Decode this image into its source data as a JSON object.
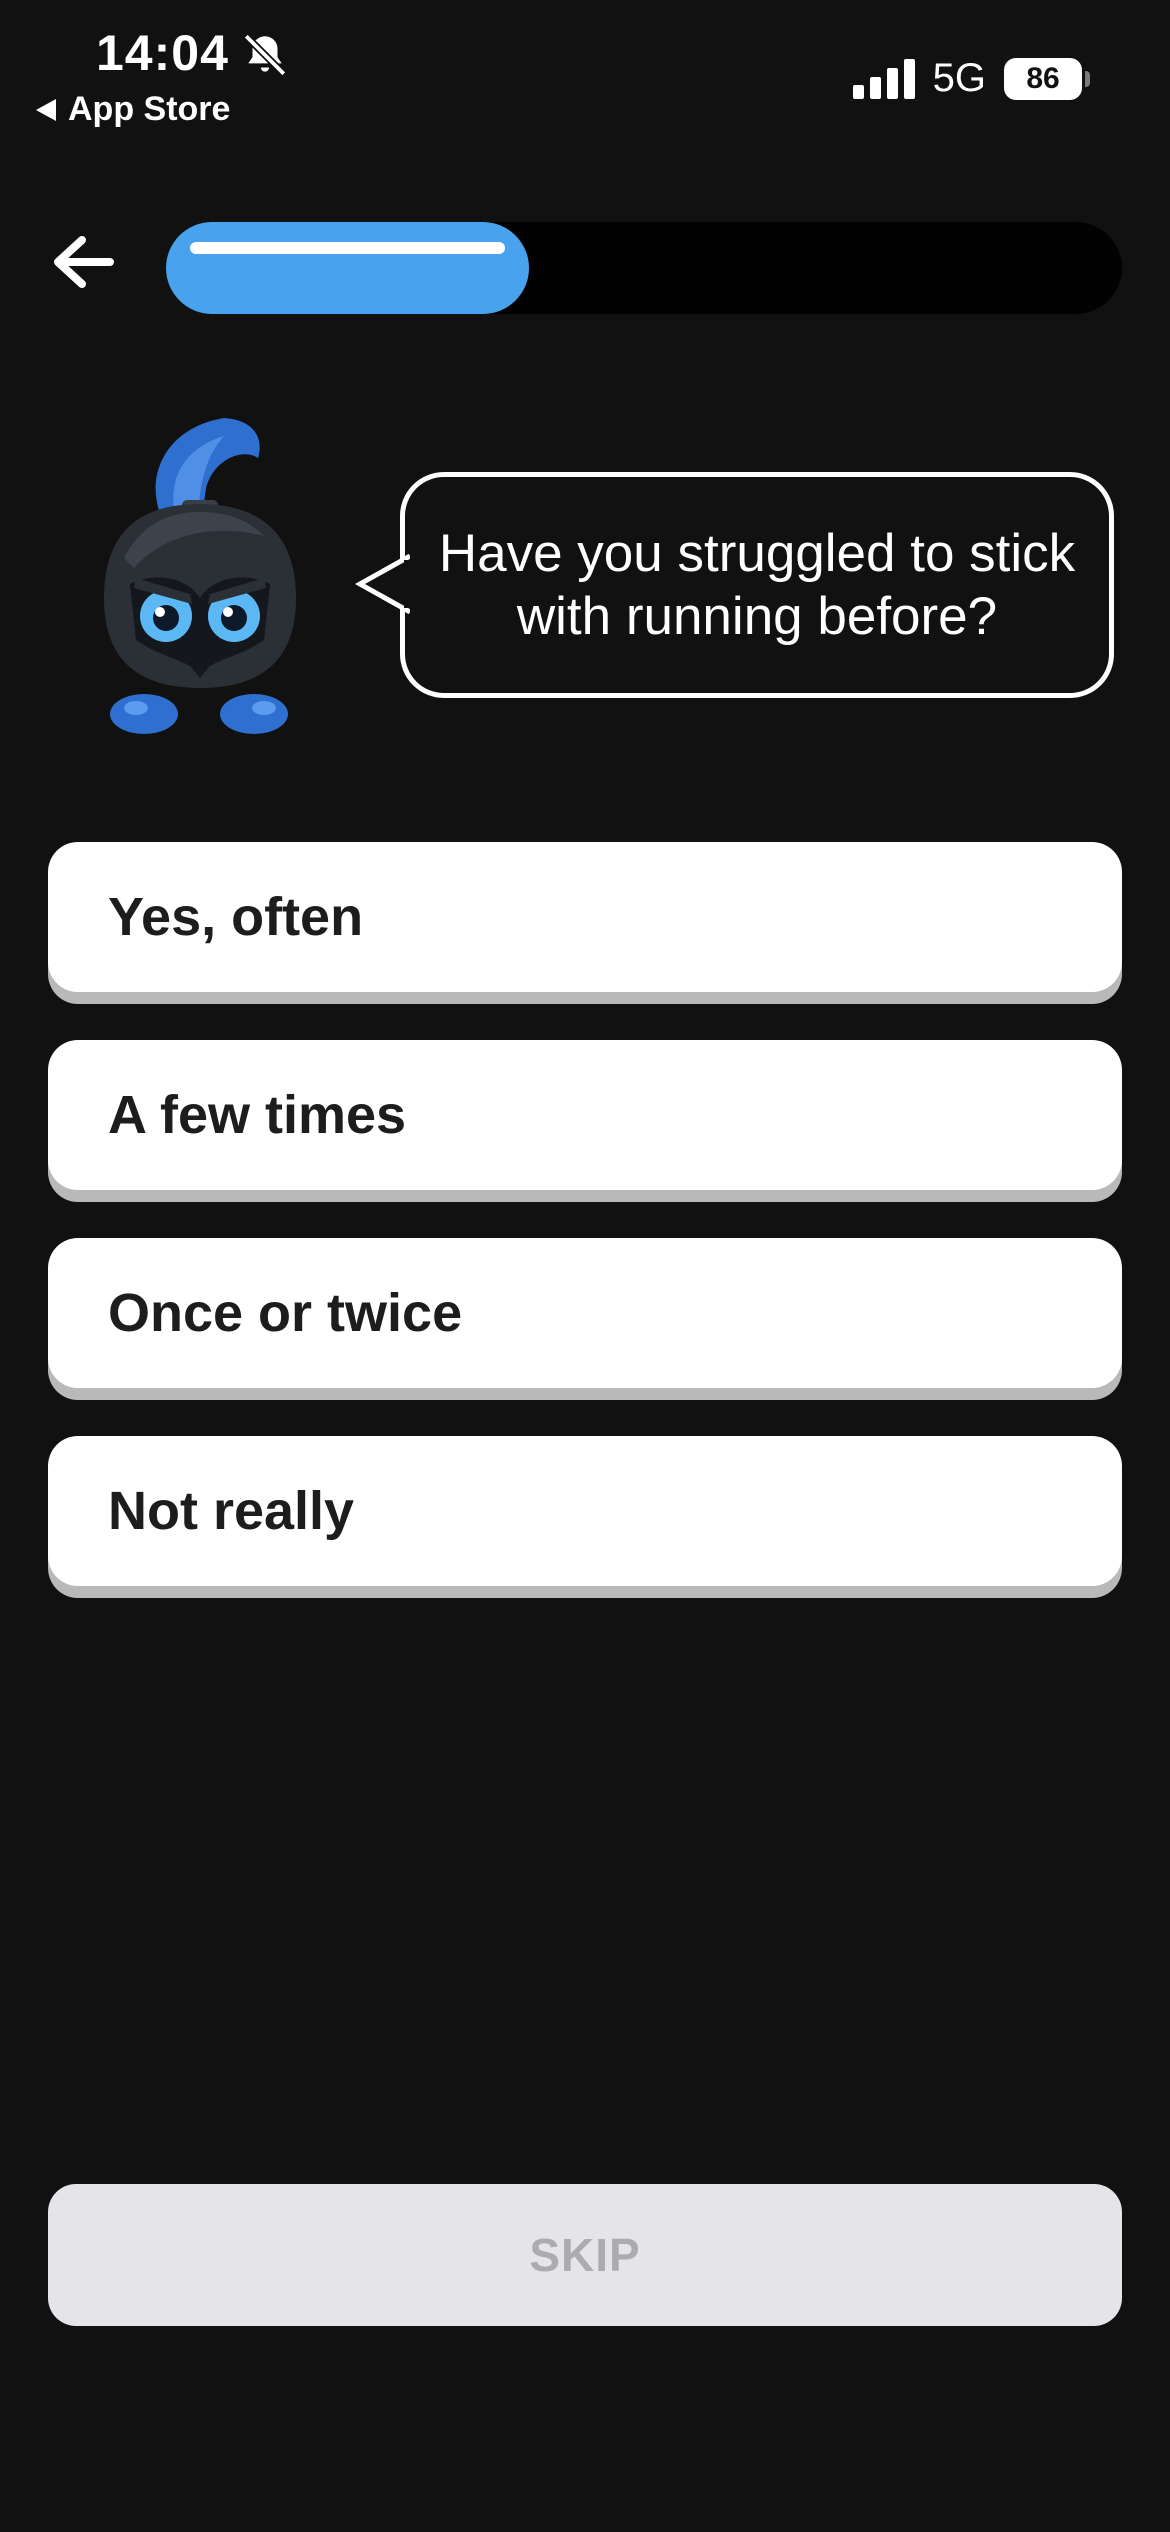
{
  "status_bar": {
    "time": "14:04",
    "back_app": "App Store",
    "network": "5G",
    "battery": "86",
    "icons": [
      "bell-slash-icon",
      "signal-bars-icon",
      "battery-icon"
    ]
  },
  "header": {
    "back_icon": "arrow-left-icon",
    "progress": 0.38,
    "progress_color": "#49a2ee"
  },
  "mascot": {
    "icon": "spartan-helmet-mascot"
  },
  "question": {
    "text": "Have you struggled to stick with running before?"
  },
  "options": [
    {
      "label": "Yes, often"
    },
    {
      "label": "A few times"
    },
    {
      "label": "Once or twice"
    },
    {
      "label": "Not really"
    }
  ],
  "skip": {
    "label": "SKIP"
  },
  "colors": {
    "background": "#111111",
    "accent": "#49a2ee",
    "option_bg": "#ffffff",
    "skip_bg": "#e5e5e9"
  }
}
